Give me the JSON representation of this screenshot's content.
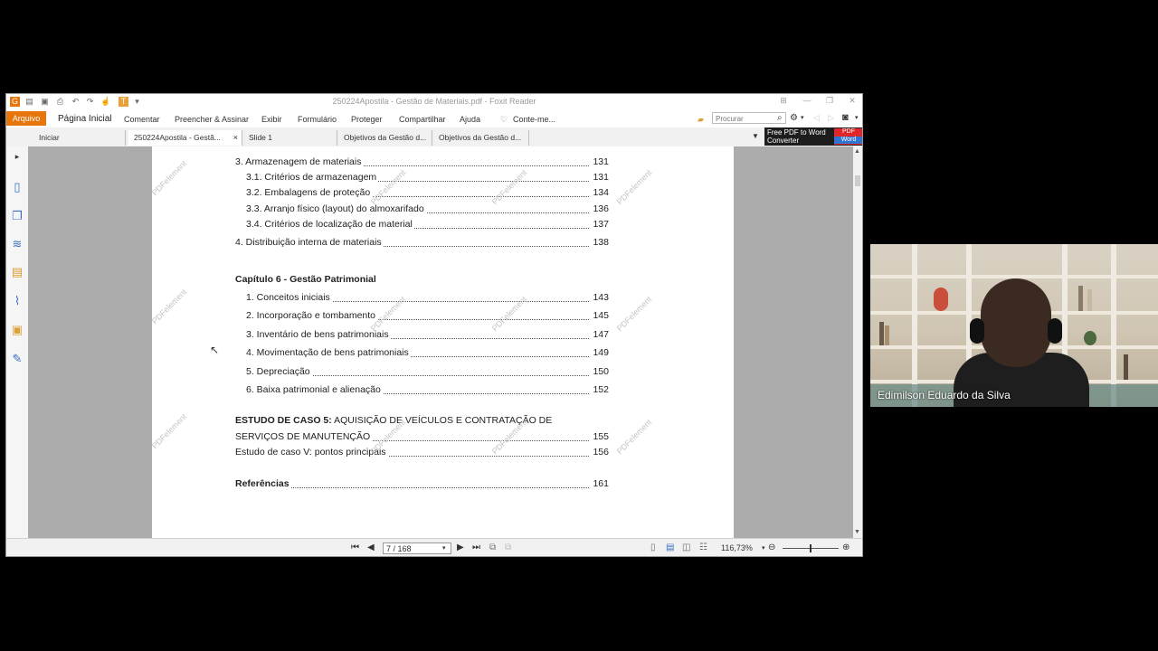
{
  "window": {
    "title": "250224Apostila - Gestão de Materiais.pdf - Foxit Reader"
  },
  "ribbon": {
    "file_tab": "Arquivo",
    "home": "Página Inicial",
    "comment": "Comentar",
    "fill_sign": "Preencher & Assinar",
    "view": "Exibir",
    "form": "Formulário",
    "protect": "Proteger",
    "share": "Compartilhar",
    "help": "Ajuda",
    "tell_me": "Conte-me...",
    "search_placeholder": "Procurar"
  },
  "tabs": [
    {
      "label": "Iniciar"
    },
    {
      "label": "250224Apostila - Gestã...",
      "close": "×"
    },
    {
      "label": "Slide 1"
    },
    {
      "label": "Objetivos da Gestão d..."
    },
    {
      "label": "Objetivos da Gestão d..."
    }
  ],
  "promo": {
    "line1": "Free PDF to Word",
    "line2": "Converter",
    "badge_top": "PDF",
    "badge_bottom": "Word"
  },
  "document": {
    "toc": [
      {
        "label": "3. Armazenagem de materiais",
        "page": "131"
      },
      {
        "label": "3.1. Critérios de armazenagem",
        "page": "131"
      },
      {
        "label": "3.2. Embalagens de proteção",
        "page": "134"
      },
      {
        "label": "3.3. Arranjo físico (layout) do almoxarifado",
        "page": "136"
      },
      {
        "label": "3.4. Critérios de localização de material",
        "page": "137"
      },
      {
        "label": "4. Distribuição interna de materiais",
        "page": "138"
      },
      {
        "label": "1. Conceitos iniciais",
        "page": "143"
      },
      {
        "label": "2. Incorporação e tombamento",
        "page": "145"
      },
      {
        "label": "3. Inventário de bens patrimoniais",
        "page": "147"
      },
      {
        "label": "4. Movimentação de bens patrimoniais",
        "page": "149"
      },
      {
        "label": "5. Depreciação",
        "page": "150"
      },
      {
        "label": "6. Baixa patrimonial e alienação",
        "page": "152"
      },
      {
        "label": "SERVIÇOS DE MANUTENÇÃO",
        "page": "155"
      },
      {
        "label": "Estudo de caso V: pontos principais",
        "page": "156"
      },
      {
        "label": "Referências",
        "page": "161"
      }
    ],
    "chapter6": "Capítulo 6 - Gestão Patrimonial",
    "case_bold": "ESTUDO DE CASO 5:",
    "case_rest": " AQUISIÇÃO DE VEÍCULOS E CONTRATAÇÃO DE",
    "watermark": "PDFelement"
  },
  "status": {
    "page_indicator": "7 / 168",
    "zoom": "116,73%"
  },
  "webcam": {
    "name": "Edimilson Eduardo da Silva"
  }
}
